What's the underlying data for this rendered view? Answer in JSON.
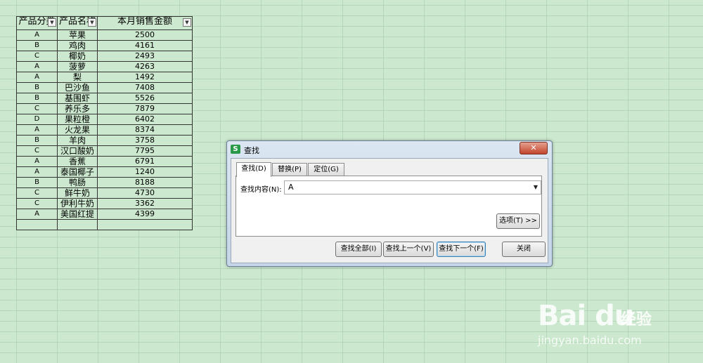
{
  "table": {
    "headers": [
      "产品分类",
      "产品名称",
      "本月销售金额"
    ],
    "rows": [
      [
        "A",
        "苹果",
        "2500"
      ],
      [
        "B",
        "鸡肉",
        "4161"
      ],
      [
        "C",
        "椰奶",
        "2493"
      ],
      [
        "A",
        "菠萝",
        "4263"
      ],
      [
        "A",
        "梨",
        "1492"
      ],
      [
        "B",
        "巴沙鱼",
        "7408"
      ],
      [
        "B",
        "基围虾",
        "5526"
      ],
      [
        "C",
        "养乐多",
        "7879"
      ],
      [
        "D",
        "果粒橙",
        "6402"
      ],
      [
        "A",
        "火龙果",
        "8374"
      ],
      [
        "B",
        "羊肉",
        "3758"
      ],
      [
        "C",
        "汉口酸奶",
        "7795"
      ],
      [
        "A",
        "香蕉",
        "6791"
      ],
      [
        "A",
        "泰国椰子",
        "1240"
      ],
      [
        "B",
        "鸭肠",
        "8188"
      ],
      [
        "C",
        "鲜牛奶",
        "4730"
      ],
      [
        "C",
        "伊利牛奶",
        "3362"
      ],
      [
        "A",
        "美国红提",
        "4399"
      ]
    ]
  },
  "dialog": {
    "title": "查找",
    "logo": "S",
    "close_glyph": "✕",
    "tabs": [
      "查找(D)",
      "替换(P)",
      "定位(G)"
    ],
    "active_tab": 0,
    "find_label": "查找内容(N):",
    "find_value": "A",
    "options_label": "选项(T) >>",
    "buttons": {
      "find_all": "查找全部(I)",
      "find_prev": "查找上一个(V)",
      "find_next": "查找下一个(F)",
      "close": "关闭"
    }
  },
  "watermark": {
    "brand": "Bai du",
    "cn": "经验",
    "url": "jingyan.baidu.com"
  },
  "colors": {
    "sheet_bg": "#cce8cf",
    "dialog_frame": "#c6d6e8",
    "close_red": "#c2452d"
  }
}
